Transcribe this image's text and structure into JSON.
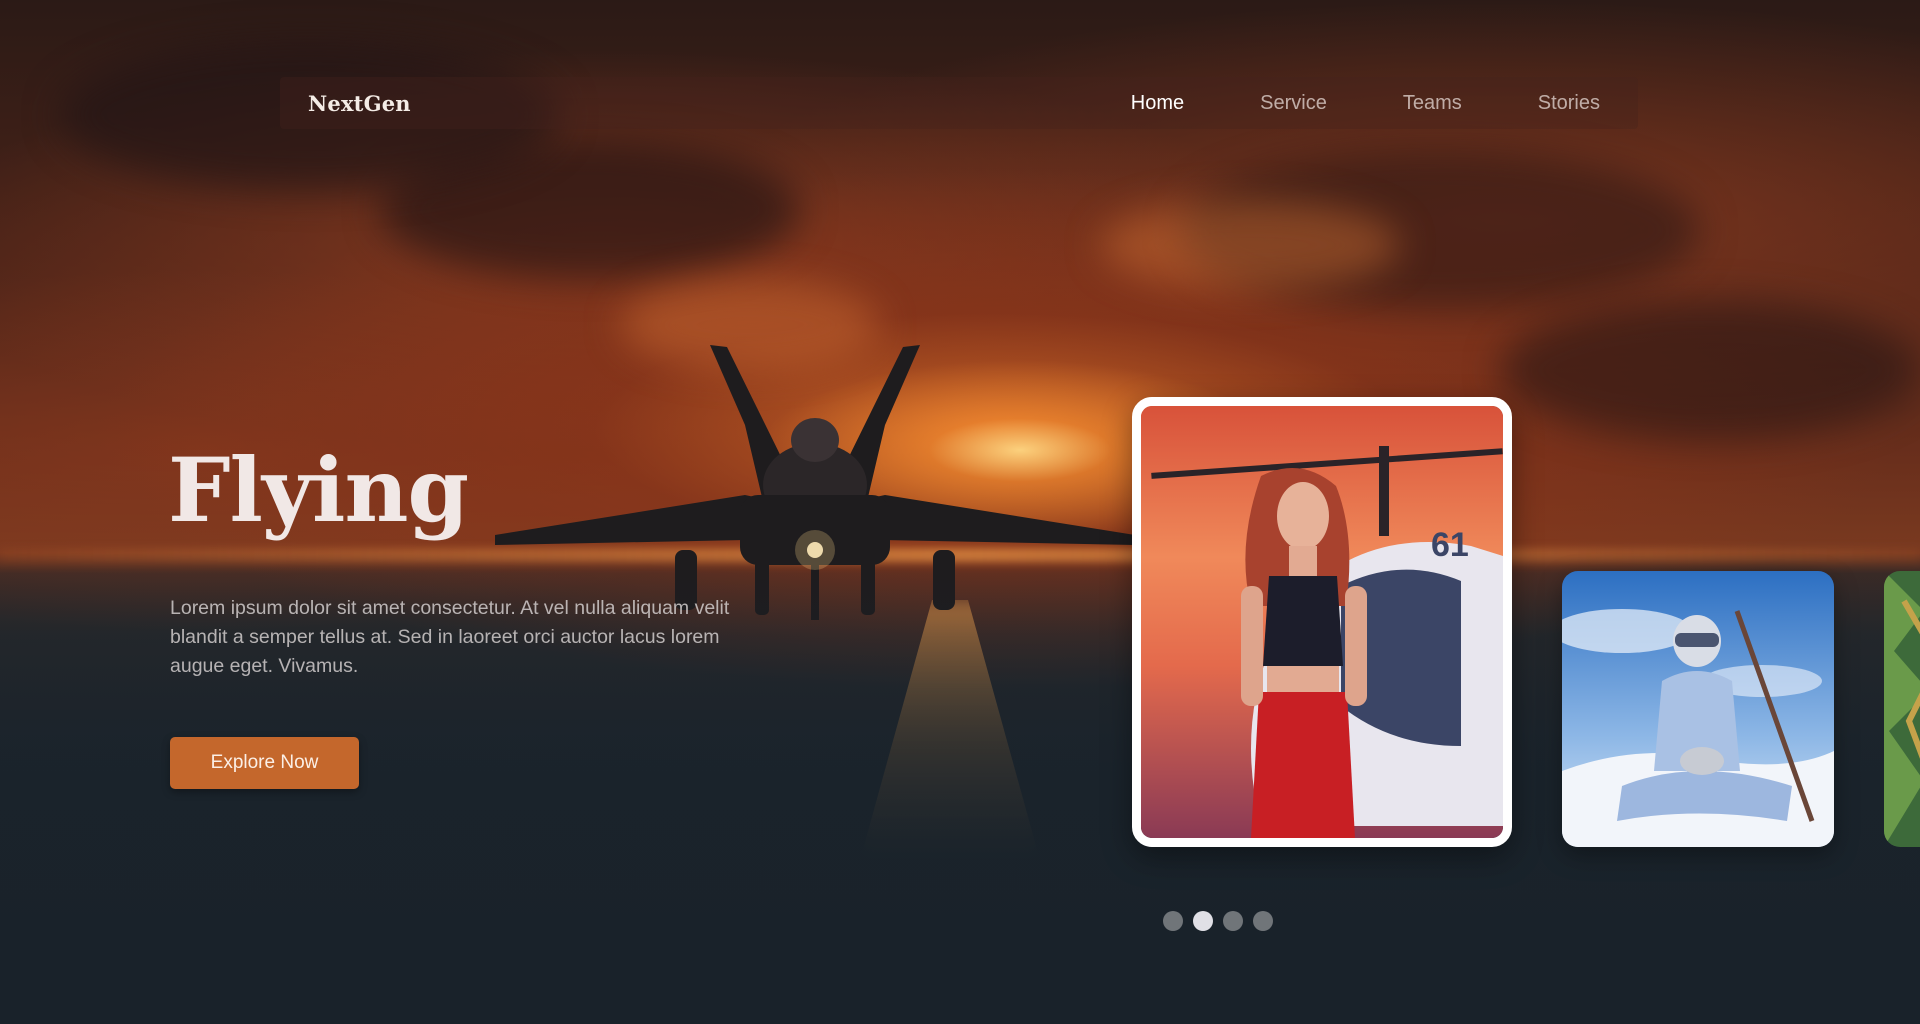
{
  "brand": {
    "name": "NextGen"
  },
  "nav": {
    "items": [
      {
        "label": "Home",
        "active": true
      },
      {
        "label": "Service",
        "active": false
      },
      {
        "label": "Teams",
        "active": false
      },
      {
        "label": "Stories",
        "active": false
      }
    ]
  },
  "hero": {
    "title": "Flying",
    "description": "Lorem ipsum dolor sit amet consectetur. At vel nulla aliquam velit blandit a semper tellus at. Sed in laoreet orci auctor lacus lorem augue eget. Vivamus.",
    "cta_label": "Explore Now",
    "cta_color": "#c4672c"
  },
  "carousel": {
    "cards": [
      {
        "image": "woman-with-helicopter-at-sunset",
        "selected": true
      },
      {
        "image": "skier-sitting-in-snow",
        "selected": false
      },
      {
        "image": "tropical-foliage",
        "selected": false
      }
    ],
    "pages": 4,
    "active_page": 2
  },
  "colors": {
    "accent": "#c4672c",
    "background": "#1a232b",
    "sky": "#6a2f1c"
  }
}
